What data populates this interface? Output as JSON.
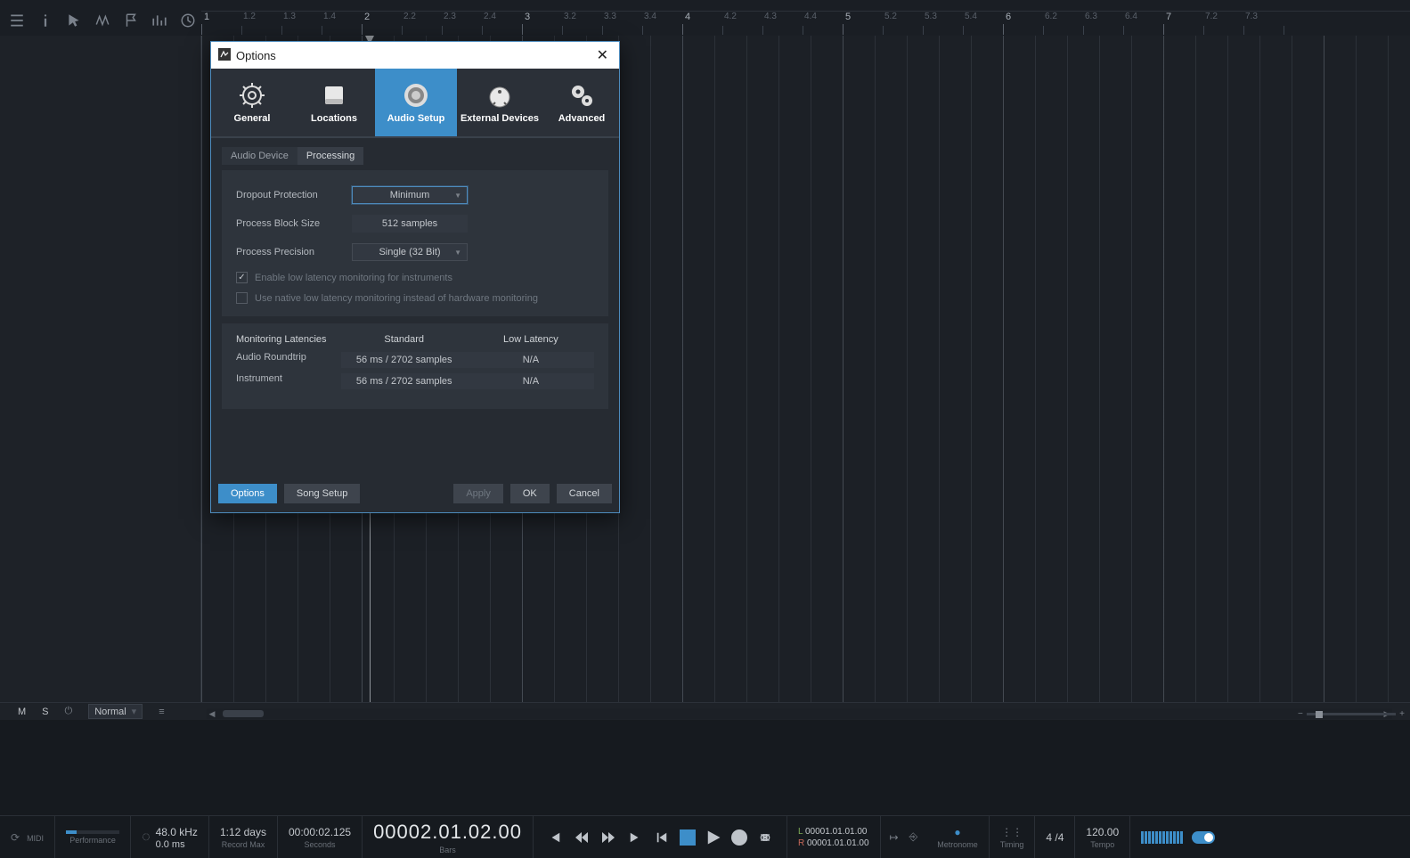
{
  "ruler": {
    "majors": [
      "1",
      "2",
      "3",
      "4",
      "5",
      "6",
      "7"
    ],
    "minors": [
      "1.2",
      "1.3",
      "1.4",
      "2.2",
      "2.3",
      "2.4",
      "3.2",
      "3.3",
      "3.4",
      "4.2",
      "4.3",
      "4.4",
      "5.2",
      "5.3",
      "5.4",
      "6.2",
      "6.3",
      "6.4",
      "7.2",
      "7.3"
    ],
    "timesig": "4/4"
  },
  "track_footer": {
    "mute": "M",
    "solo": "S",
    "mode": "Normal"
  },
  "transport": {
    "midi_label": "MIDI",
    "perf_label": "Performance",
    "sample_rate": "48.0 kHz",
    "latency_ms": "0.0 ms",
    "rec_max_val": "1:12 days",
    "rec_max_label": "Record Max",
    "seconds_val": "00:00:02.125",
    "seconds_label": "Seconds",
    "bars_val": "00002.01.02.00",
    "bars_label": "Bars",
    "loc_L": "00001.01.01.00",
    "loc_R": "00001.01.01.00",
    "loc_L_tag": "L",
    "loc_R_tag": "R",
    "metronome_label": "Metronome",
    "timing_label": "Timing",
    "timesig_val": "4 /4",
    "tempo_val": "120.00",
    "tempo_label": "Tempo"
  },
  "dialog": {
    "title": "Options",
    "categories": [
      "General",
      "Locations",
      "Audio Setup",
      "External Devices",
      "Advanced"
    ],
    "tabs": [
      "Audio Device",
      "Processing"
    ],
    "dropout_label": "Dropout Protection",
    "dropout_value": "Minimum",
    "blocksize_label": "Process Block Size",
    "blocksize_value": "512 samples",
    "precision_label": "Process Precision",
    "precision_value": "Single (32 Bit)",
    "chk1": "Enable low latency monitoring for instruments",
    "chk2": "Use native low latency monitoring instead of hardware monitoring",
    "lat_header": [
      "Monitoring Latencies",
      "Standard",
      "Low Latency"
    ],
    "lat_rows": [
      {
        "label": "Audio Roundtrip",
        "std": "56 ms / 2702 samples",
        "low": "N/A"
      },
      {
        "label": "Instrument",
        "std": "56 ms / 2702 samples",
        "low": "N/A"
      }
    ],
    "footer": {
      "options": "Options",
      "songsetup": "Song Setup",
      "apply": "Apply",
      "ok": "OK",
      "cancel": "Cancel"
    }
  }
}
